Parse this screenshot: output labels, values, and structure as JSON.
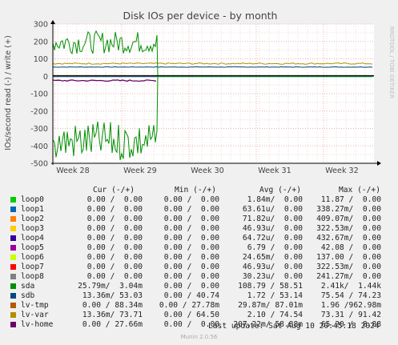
{
  "chart_data": {
    "type": "line",
    "title": "Disk IOs per device - by month",
    "ylabel": "IOs/second read (-) / write (+)",
    "side_label": "RRDTOOL / TOBI OETIKER",
    "ylim": [
      -500,
      300
    ],
    "yticks": [
      300,
      200,
      100,
      0,
      -100,
      -200,
      -300,
      -400,
      -500
    ],
    "xticks": [
      "Week 28",
      "Week 29",
      "Week 30",
      "Week 31",
      "Week 32"
    ],
    "grid": true,
    "colors": {
      "loop0": "#00cc00",
      "loop1": "#0066b3",
      "loop2": "#ff8000",
      "loop3": "#ffcc00",
      "loop4": "#330099",
      "loop5": "#990099",
      "loop6": "#ccff00",
      "loop7": "#ff0000",
      "loop8": "#808080",
      "sda": "#008f00",
      "sdb": "#00487d",
      "lv-tmp": "#b35a00",
      "lv-var": "#b38f00",
      "lv-home": "#6b006b"
    },
    "series": [
      {
        "name": "sda",
        "write_until_week29": "about 100 to 270",
        "read_until_week29": "about -250 to -500",
        "after_week29": 0
      },
      {
        "name": "lv-var",
        "write": 73,
        "read": -2
      },
      {
        "name": "sdb",
        "write": 53,
        "read": -14
      },
      {
        "name": "lv-tmp",
        "write": 88,
        "read": 0
      },
      {
        "name": "lv-home",
        "write": 27,
        "read_until_week29": -25,
        "after_week29": 0
      }
    ]
  },
  "legend": {
    "headers": {
      "cur": "Cur (-/+)",
      "min": "Min (-/+)",
      "avg": "Avg (-/+)",
      "max": "Max (-/+)"
    },
    "rows": [
      {
        "name": "loop0",
        "cur": "0.00 /  0.00",
        "min": "0.00 /  0.00",
        "avg": "1.84m/  0.00",
        "max": "11.87 /  0.00"
      },
      {
        "name": "loop1",
        "cur": "0.00 /  0.00",
        "min": "0.00 /  0.00",
        "avg": "63.61u/  0.00",
        "max": "338.27m/  0.00"
      },
      {
        "name": "loop2",
        "cur": "0.00 /  0.00",
        "min": "0.00 /  0.00",
        "avg": "71.82u/  0.00",
        "max": "409.07m/  0.00"
      },
      {
        "name": "loop3",
        "cur": "0.00 /  0.00",
        "min": "0.00 /  0.00",
        "avg": "46.93u/  0.00",
        "max": "322.53m/  0.00"
      },
      {
        "name": "loop4",
        "cur": "0.00 /  0.00",
        "min": "0.00 /  0.00",
        "avg": "64.72u/  0.00",
        "max": "432.67m/  0.00"
      },
      {
        "name": "loop5",
        "cur": "0.00 /  0.00",
        "min": "0.00 /  0.00",
        "avg": "6.79 /  0.00",
        "max": "42.08 /  0.00"
      },
      {
        "name": "loop6",
        "cur": "0.00 /  0.00",
        "min": "0.00 /  0.00",
        "avg": "24.65m/  0.00",
        "max": "137.00 /  0.00"
      },
      {
        "name": "loop7",
        "cur": "0.00 /  0.00",
        "min": "0.00 /  0.00",
        "avg": "46.93u/  0.00",
        "max": "322.53m/  0.00"
      },
      {
        "name": "loop8",
        "cur": "0.00 /  0.00",
        "min": "0.00 /  0.00",
        "avg": "30.23u/  0.00",
        "max": "241.27m/  0.00"
      },
      {
        "name": "sda",
        "cur": "25.79m/  3.04m",
        "min": "0.00 /  0.00",
        "avg": "108.79 / 58.51",
        "max": "2.41k/  1.44k"
      },
      {
        "name": "sdb",
        "cur": "13.36m/ 53.03",
        "min": "0.00 / 40.74",
        "avg": "1.72 / 53.14",
        "max": "75.54 / 74.23"
      },
      {
        "name": "lv-tmp",
        "cur": "0.00 / 88.34m",
        "min": "0.00 / 27.78m",
        "avg": "29.87m/ 87.01m",
        "max": "1.96 /962.98m"
      },
      {
        "name": "lv-var",
        "cur": "13.36m/ 73.71",
        "min": "0.00 / 64.50",
        "avg": "2.10 / 74.54",
        "max": "73.31 / 91.42"
      },
      {
        "name": "lv-home",
        "cur": "0.00 / 27.66m",
        "min": "0.00 /  0.00",
        "avg": "207.22m/ 58.88m",
        "max": "65.20 /  8.88"
      }
    ]
  },
  "footer": {
    "last_update": "Last update: Sat Aug 10 20:45:18 2024",
    "munin": "Munin 2.0.56"
  }
}
